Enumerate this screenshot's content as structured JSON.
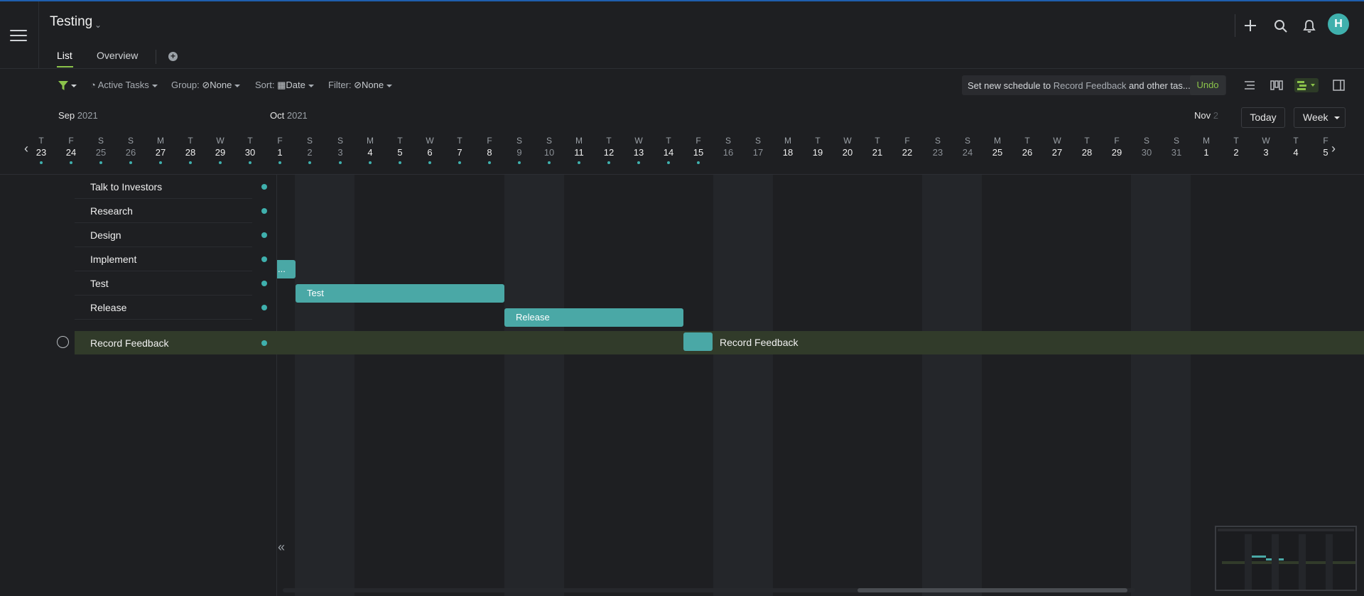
{
  "header": {
    "title": "Testing",
    "tabs": [
      {
        "label": "List",
        "active": true
      },
      {
        "label": "Overview",
        "active": false
      }
    ],
    "avatar_initial": "H"
  },
  "toolbar": {
    "active_tasks": "Active Tasks",
    "group_label": "Group:",
    "group_value": "None",
    "sort_label": "Sort:",
    "sort_value": "Date",
    "filter_label": "Filter:",
    "filter_value": "None",
    "notice_prefix": "Set new schedule to",
    "notice_task": "Record Feedback",
    "notice_suffix": "and other tas...",
    "undo_label": "Undo"
  },
  "timeline": {
    "months": [
      {
        "name": "Sep",
        "year": "2021"
      },
      {
        "name": "Oct",
        "year": "2021"
      },
      {
        "name": "Nov",
        "year": "2"
      }
    ],
    "today_label": "Today",
    "scale_label": "Week",
    "days": [
      {
        "l": "T",
        "n": "23",
        "we": false,
        "dot": true
      },
      {
        "l": "F",
        "n": "24",
        "we": false,
        "dot": true
      },
      {
        "l": "S",
        "n": "25",
        "we": true,
        "dot": true
      },
      {
        "l": "S",
        "n": "26",
        "we": true,
        "dot": true
      },
      {
        "l": "M",
        "n": "27",
        "we": false,
        "dot": true
      },
      {
        "l": "T",
        "n": "28",
        "we": false,
        "dot": true
      },
      {
        "l": "W",
        "n": "29",
        "we": false,
        "dot": true
      },
      {
        "l": "T",
        "n": "30",
        "we": false,
        "dot": true
      },
      {
        "l": "F",
        "n": "1",
        "we": false,
        "dot": true
      },
      {
        "l": "S",
        "n": "2",
        "we": true,
        "dot": true
      },
      {
        "l": "S",
        "n": "3",
        "we": true,
        "dot": true
      },
      {
        "l": "M",
        "n": "4",
        "we": false,
        "dot": true
      },
      {
        "l": "T",
        "n": "5",
        "we": false,
        "dot": true
      },
      {
        "l": "W",
        "n": "6",
        "we": false,
        "dot": true
      },
      {
        "l": "T",
        "n": "7",
        "we": false,
        "dot": true
      },
      {
        "l": "F",
        "n": "8",
        "we": false,
        "dot": true
      },
      {
        "l": "S",
        "n": "9",
        "we": true,
        "dot": true
      },
      {
        "l": "S",
        "n": "10",
        "we": true,
        "dot": true
      },
      {
        "l": "M",
        "n": "11",
        "we": false,
        "dot": true
      },
      {
        "l": "T",
        "n": "12",
        "we": false,
        "dot": true
      },
      {
        "l": "W",
        "n": "13",
        "we": false,
        "dot": true
      },
      {
        "l": "T",
        "n": "14",
        "we": false,
        "dot": true
      },
      {
        "l": "F",
        "n": "15",
        "we": false,
        "dot": true
      },
      {
        "l": "S",
        "n": "16",
        "we": true,
        "dot": false
      },
      {
        "l": "S",
        "n": "17",
        "we": true,
        "dot": false
      },
      {
        "l": "M",
        "n": "18",
        "we": false,
        "dot": false
      },
      {
        "l": "T",
        "n": "19",
        "we": false,
        "dot": false
      },
      {
        "l": "W",
        "n": "20",
        "we": false,
        "dot": false
      },
      {
        "l": "T",
        "n": "21",
        "we": false,
        "dot": false
      },
      {
        "l": "F",
        "n": "22",
        "we": false,
        "dot": false
      },
      {
        "l": "S",
        "n": "23",
        "we": true,
        "dot": false
      },
      {
        "l": "S",
        "n": "24",
        "we": true,
        "dot": false
      },
      {
        "l": "M",
        "n": "25",
        "we": false,
        "dot": false
      },
      {
        "l": "T",
        "n": "26",
        "we": false,
        "dot": false
      },
      {
        "l": "W",
        "n": "27",
        "we": false,
        "dot": false
      },
      {
        "l": "T",
        "n": "28",
        "we": false,
        "dot": false
      },
      {
        "l": "F",
        "n": "29",
        "we": false,
        "dot": false
      },
      {
        "l": "S",
        "n": "30",
        "we": true,
        "dot": false
      },
      {
        "l": "S",
        "n": "31",
        "we": true,
        "dot": false
      },
      {
        "l": "M",
        "n": "1",
        "we": false,
        "dot": false
      },
      {
        "l": "T",
        "n": "2",
        "we": false,
        "dot": false
      },
      {
        "l": "W",
        "n": "3",
        "we": false,
        "dot": false
      },
      {
        "l": "T",
        "n": "4",
        "we": false,
        "dot": false
      },
      {
        "l": "F",
        "n": "5",
        "we": false,
        "dot": false
      }
    ]
  },
  "tasks": [
    {
      "name": "Talk to Investors"
    },
    {
      "name": "Research"
    },
    {
      "name": "Design"
    },
    {
      "name": "Implement"
    },
    {
      "name": "Test"
    },
    {
      "name": "Release"
    },
    {
      "name": "Record Feedback"
    }
  ],
  "bars": [
    {
      "label": "..."
    },
    {
      "label": "Test"
    },
    {
      "label": "Release"
    },
    {
      "label": "Record Feedback"
    }
  ],
  "colors": {
    "accent": "#8bc34a",
    "bar": "#4aa8a6",
    "avatar": "#3fb0ad"
  }
}
